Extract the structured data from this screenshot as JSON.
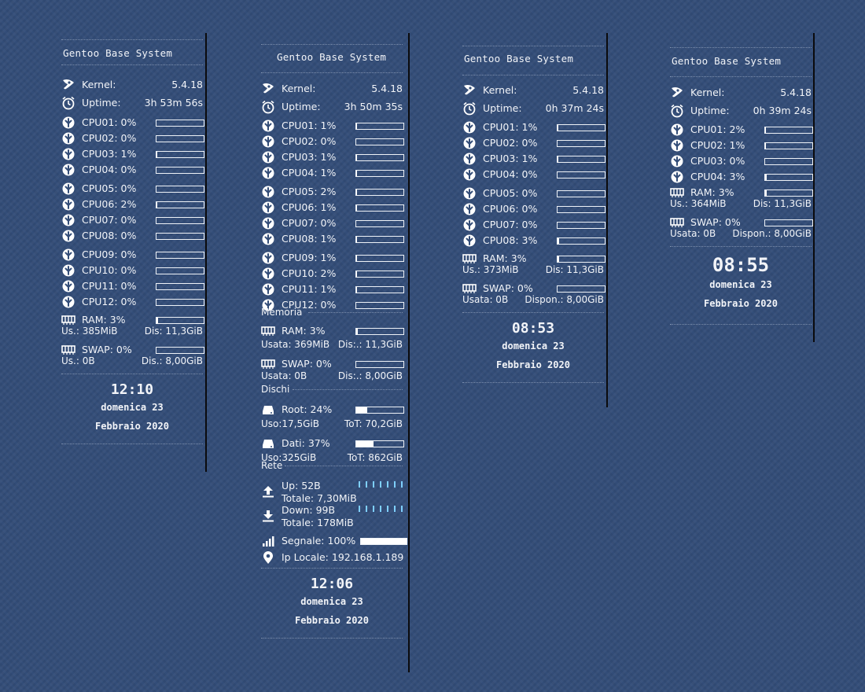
{
  "title": "Gentoo Base System",
  "kernel_label": "Kernel:",
  "uptime_label": "Uptime:",
  "kernel_version": "5.4.18",
  "colors": {
    "background": "#334d78",
    "text": "#f2f4f8",
    "divider": "#0b0b0d",
    "bar_border": "#eef2f7"
  },
  "panels": [
    {
      "uptime": "3h 53m 56s",
      "cpus": [
        {
          "label": "CPU01:",
          "value": "0%",
          "fraction": 0.0
        },
        {
          "label": "CPU02:",
          "value": "0%",
          "fraction": 0.0
        },
        {
          "label": "CPU03:",
          "value": "1%",
          "fraction": 0.01
        },
        {
          "label": "CPU04:",
          "value": "0%",
          "fraction": 0.0
        },
        {
          "label": "CPU05:",
          "value": "0%",
          "fraction": 0.0
        },
        {
          "label": "CPU06:",
          "value": "2%",
          "fraction": 0.02
        },
        {
          "label": "CPU07:",
          "value": "0%",
          "fraction": 0.0
        },
        {
          "label": "CPU08:",
          "value": "0%",
          "fraction": 0.0
        },
        {
          "label": "CPU09:",
          "value": "0%",
          "fraction": 0.0
        },
        {
          "label": "CPU10:",
          "value": "0%",
          "fraction": 0.0
        },
        {
          "label": "CPU11:",
          "value": "0%",
          "fraction": 0.0
        },
        {
          "label": "CPU12:",
          "value": "0%",
          "fraction": 0.0
        }
      ],
      "ram": {
        "label": "RAM: 3%",
        "fraction": 0.03,
        "used": "Us.: 385MiB",
        "free": "Dis: 11,3GiB"
      },
      "swap": {
        "label": "SWAP: 0%",
        "fraction": 0.0,
        "used": "Us.: 0B",
        "free": "Dis.: 8,00GiB"
      },
      "time": "12:10",
      "day": "domenica 23",
      "monthyear": "Febbraio 2020"
    },
    {
      "uptime": "3h 50m 35s",
      "cpus": [
        {
          "label": "CPU01:",
          "value": "1%",
          "fraction": 0.01
        },
        {
          "label": "CPU02:",
          "value": "0%",
          "fraction": 0.0
        },
        {
          "label": "CPU03:",
          "value": "1%",
          "fraction": 0.01
        },
        {
          "label": "CPU04:",
          "value": "1%",
          "fraction": 0.01
        },
        {
          "label": "CPU05:",
          "value": "2%",
          "fraction": 0.02
        },
        {
          "label": "CPU06:",
          "value": "1%",
          "fraction": 0.01
        },
        {
          "label": "CPU07:",
          "value": "0%",
          "fraction": 0.0
        },
        {
          "label": "CPU08:",
          "value": "1%",
          "fraction": 0.01
        },
        {
          "label": "CPU09:",
          "value": "1%",
          "fraction": 0.01
        },
        {
          "label": "CPU10:",
          "value": "2%",
          "fraction": 0.02
        },
        {
          "label": "CPU11:",
          "value": "1%",
          "fraction": 0.01
        },
        {
          "label": "CPU12:",
          "value": "0%",
          "fraction": 0.0
        }
      ],
      "memoria_label": "Memoria",
      "ram": {
        "label": "RAM: 3%",
        "fraction": 0.03,
        "used": "Usata: 369MiB",
        "free": "Dis:.: 11,3GiB"
      },
      "swap": {
        "label": "SWAP: 0%",
        "fraction": 0.0,
        "used": "Usata: 0B",
        "free": "Dis:.: 8,00GiB"
      },
      "dischi_label": "Dischi",
      "root": {
        "label": "Root: 24%",
        "fraction": 0.24,
        "used": "Uso:17,5GiB",
        "total": "ToT: 70,2GiB"
      },
      "dati": {
        "label": "Dati: 37%",
        "fraction": 0.37,
        "used": "Uso:325GiB",
        "total": "ToT: 862GiB"
      },
      "rete_label": "Rete",
      "up": {
        "label": "Up: 52B",
        "total": "Totale: 7,30MiB"
      },
      "down": {
        "label": "Down: 99B",
        "total": "Totale: 178MiB"
      },
      "signal": {
        "label": "Segnale: 100%",
        "fraction": 1.0
      },
      "ip": "Ip Locale: 192.168.1.189",
      "time": "12:06",
      "day": "domenica 23",
      "monthyear": "Febbraio 2020"
    },
    {
      "uptime": "0h 37m 24s",
      "cpus": [
        {
          "label": "CPU01:",
          "value": "1%",
          "fraction": 0.01
        },
        {
          "label": "CPU02:",
          "value": "0%",
          "fraction": 0.0
        },
        {
          "label": "CPU03:",
          "value": "1%",
          "fraction": 0.01
        },
        {
          "label": "CPU04:",
          "value": "0%",
          "fraction": 0.0
        },
        {
          "label": "CPU05:",
          "value": "0%",
          "fraction": 0.0
        },
        {
          "label": "CPU06:",
          "value": "0%",
          "fraction": 0.0
        },
        {
          "label": "CPU07:",
          "value": "0%",
          "fraction": 0.0
        },
        {
          "label": "CPU08:",
          "value": "3%",
          "fraction": 0.03
        }
      ],
      "ram": {
        "label": "RAM: 3%",
        "fraction": 0.03,
        "used": "Us.: 373MiB",
        "free": "Dis: 11,3GiB"
      },
      "swap": {
        "label": "SWAP: 0%",
        "fraction": 0.0,
        "used": "Usata: 0B",
        "free": "Dispon.: 8,00GiB"
      },
      "time": "08:53",
      "day": "domenica 23",
      "monthyear": "Febbraio 2020"
    },
    {
      "uptime": "0h 39m 24s",
      "cpus": [
        {
          "label": "CPU01:",
          "value": "2%",
          "fraction": 0.02
        },
        {
          "label": "CPU02:",
          "value": "1%",
          "fraction": 0.01
        },
        {
          "label": "CPU03:",
          "value": "0%",
          "fraction": 0.0
        },
        {
          "label": "CPU04:",
          "value": "3%",
          "fraction": 0.03
        }
      ],
      "ram": {
        "label": "RAM: 3%",
        "fraction": 0.03,
        "used": "Us.: 364MiB",
        "free": "Dis: 11,3GiB"
      },
      "swap": {
        "label": "SWAP: 0%",
        "fraction": 0.0,
        "used": "Usata: 0B",
        "free": "Dispon.: 8,00GiB"
      },
      "time": "08:55",
      "day": "domenica 23",
      "monthyear": "Febbraio 2020"
    }
  ]
}
